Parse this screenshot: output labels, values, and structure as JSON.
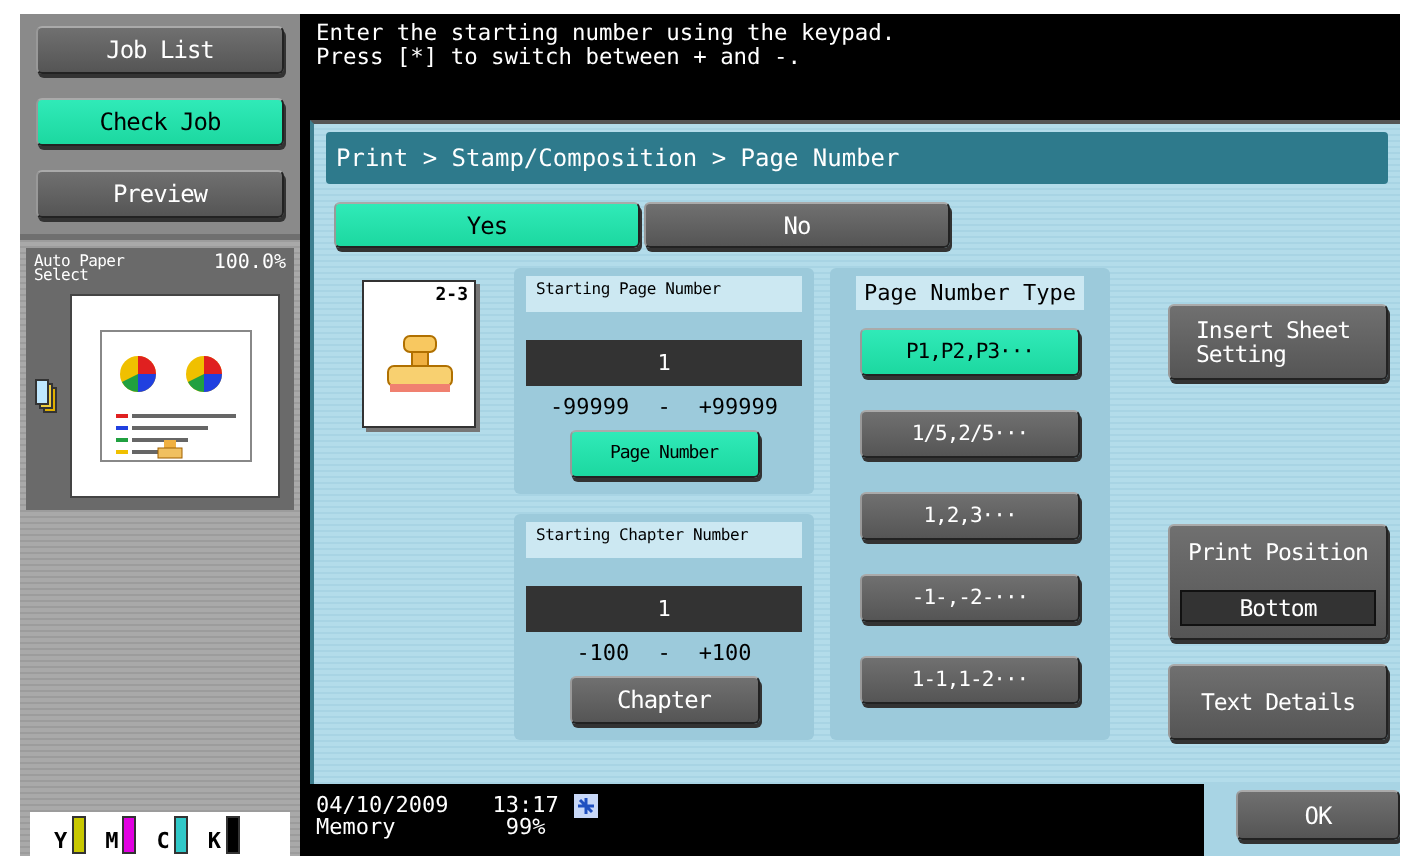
{
  "sidebar": {
    "buttons": [
      {
        "label": "Job List",
        "selected": false
      },
      {
        "label": "Check Job",
        "selected": true
      },
      {
        "label": "Preview",
        "selected": false
      }
    ],
    "paper": {
      "label": "Auto Paper Select",
      "zoom": "100.0%"
    },
    "toner": [
      {
        "label": "Y",
        "color": "#c8c800",
        "level": 1
      },
      {
        "label": "M",
        "color": "#e000e0",
        "level": 1
      },
      {
        "label": "C",
        "color": "#30c8c8",
        "level": 1
      },
      {
        "label": "K",
        "color": "#000000",
        "level": 1
      }
    ]
  },
  "message": [
    "Enter the starting number using the keypad.",
    "Press [*] to switch between + and -."
  ],
  "breadcrumb": "Print > Stamp/Composition > Page Number",
  "toggle": [
    {
      "label": "Yes",
      "selected": true
    },
    {
      "label": "No",
      "selected": false
    }
  ],
  "preview": {
    "page_label": "2-3"
  },
  "number_groups": [
    {
      "title": "Starting Page Number",
      "value": "1",
      "min": "-99999",
      "separator": "-",
      "max": "+99999",
      "button": {
        "label": "Page Number",
        "selected": true
      }
    },
    {
      "title": "Starting Chapter Number",
      "value": "1",
      "min": "-100",
      "separator": "-",
      "max": "+100",
      "button": {
        "label": "Chapter",
        "selected": false
      }
    }
  ],
  "page_number_type": {
    "title": "Page Number Type",
    "options": [
      {
        "label": "P1,P2,P3···",
        "selected": true
      },
      {
        "label": "1/5,2/5···",
        "selected": false
      },
      {
        "label": "1,2,3···",
        "selected": false
      },
      {
        "label": "-1-,-2-···",
        "selected": false
      },
      {
        "label": "1-1,1-2···",
        "selected": false
      }
    ]
  },
  "side_buttons": [
    {
      "kind": "plain",
      "label": "Insert Sheet Setting"
    },
    {
      "kind": "value",
      "label": "Print Position",
      "value": "Bottom"
    },
    {
      "kind": "plain",
      "label": "Text Details"
    }
  ],
  "status_bar": {
    "date": "04/10/2009",
    "time": "13:17",
    "memory_label": "Memory",
    "memory_value": "99%"
  },
  "ok_button": "OK"
}
